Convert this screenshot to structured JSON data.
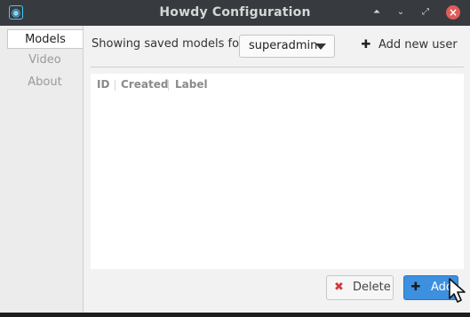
{
  "window": {
    "title": "Howdy Configuration"
  },
  "titlebar": {
    "app_icon": "app-logo-icon",
    "buttons": [
      "minimize-up-icon",
      "restore-icon",
      "maximize-icon",
      "close-icon"
    ]
  },
  "sidebar": {
    "items": [
      {
        "label": "Models",
        "active": true
      },
      {
        "label": "Video",
        "active": false
      },
      {
        "label": "About",
        "active": false
      }
    ]
  },
  "models": {
    "showing_label": "Showing saved models for:",
    "user_select_value": "superadmin",
    "add_user_label": "Add new user",
    "columns": [
      "ID",
      "Created",
      "Label"
    ],
    "rows": []
  },
  "actions": {
    "delete_label": "Delete",
    "add_label": "Add"
  },
  "colors": {
    "accent": "#3d8fe0",
    "titlebar": "#373b3f",
    "close": "#e25b5b",
    "delete_icon": "#d43a3a"
  }
}
